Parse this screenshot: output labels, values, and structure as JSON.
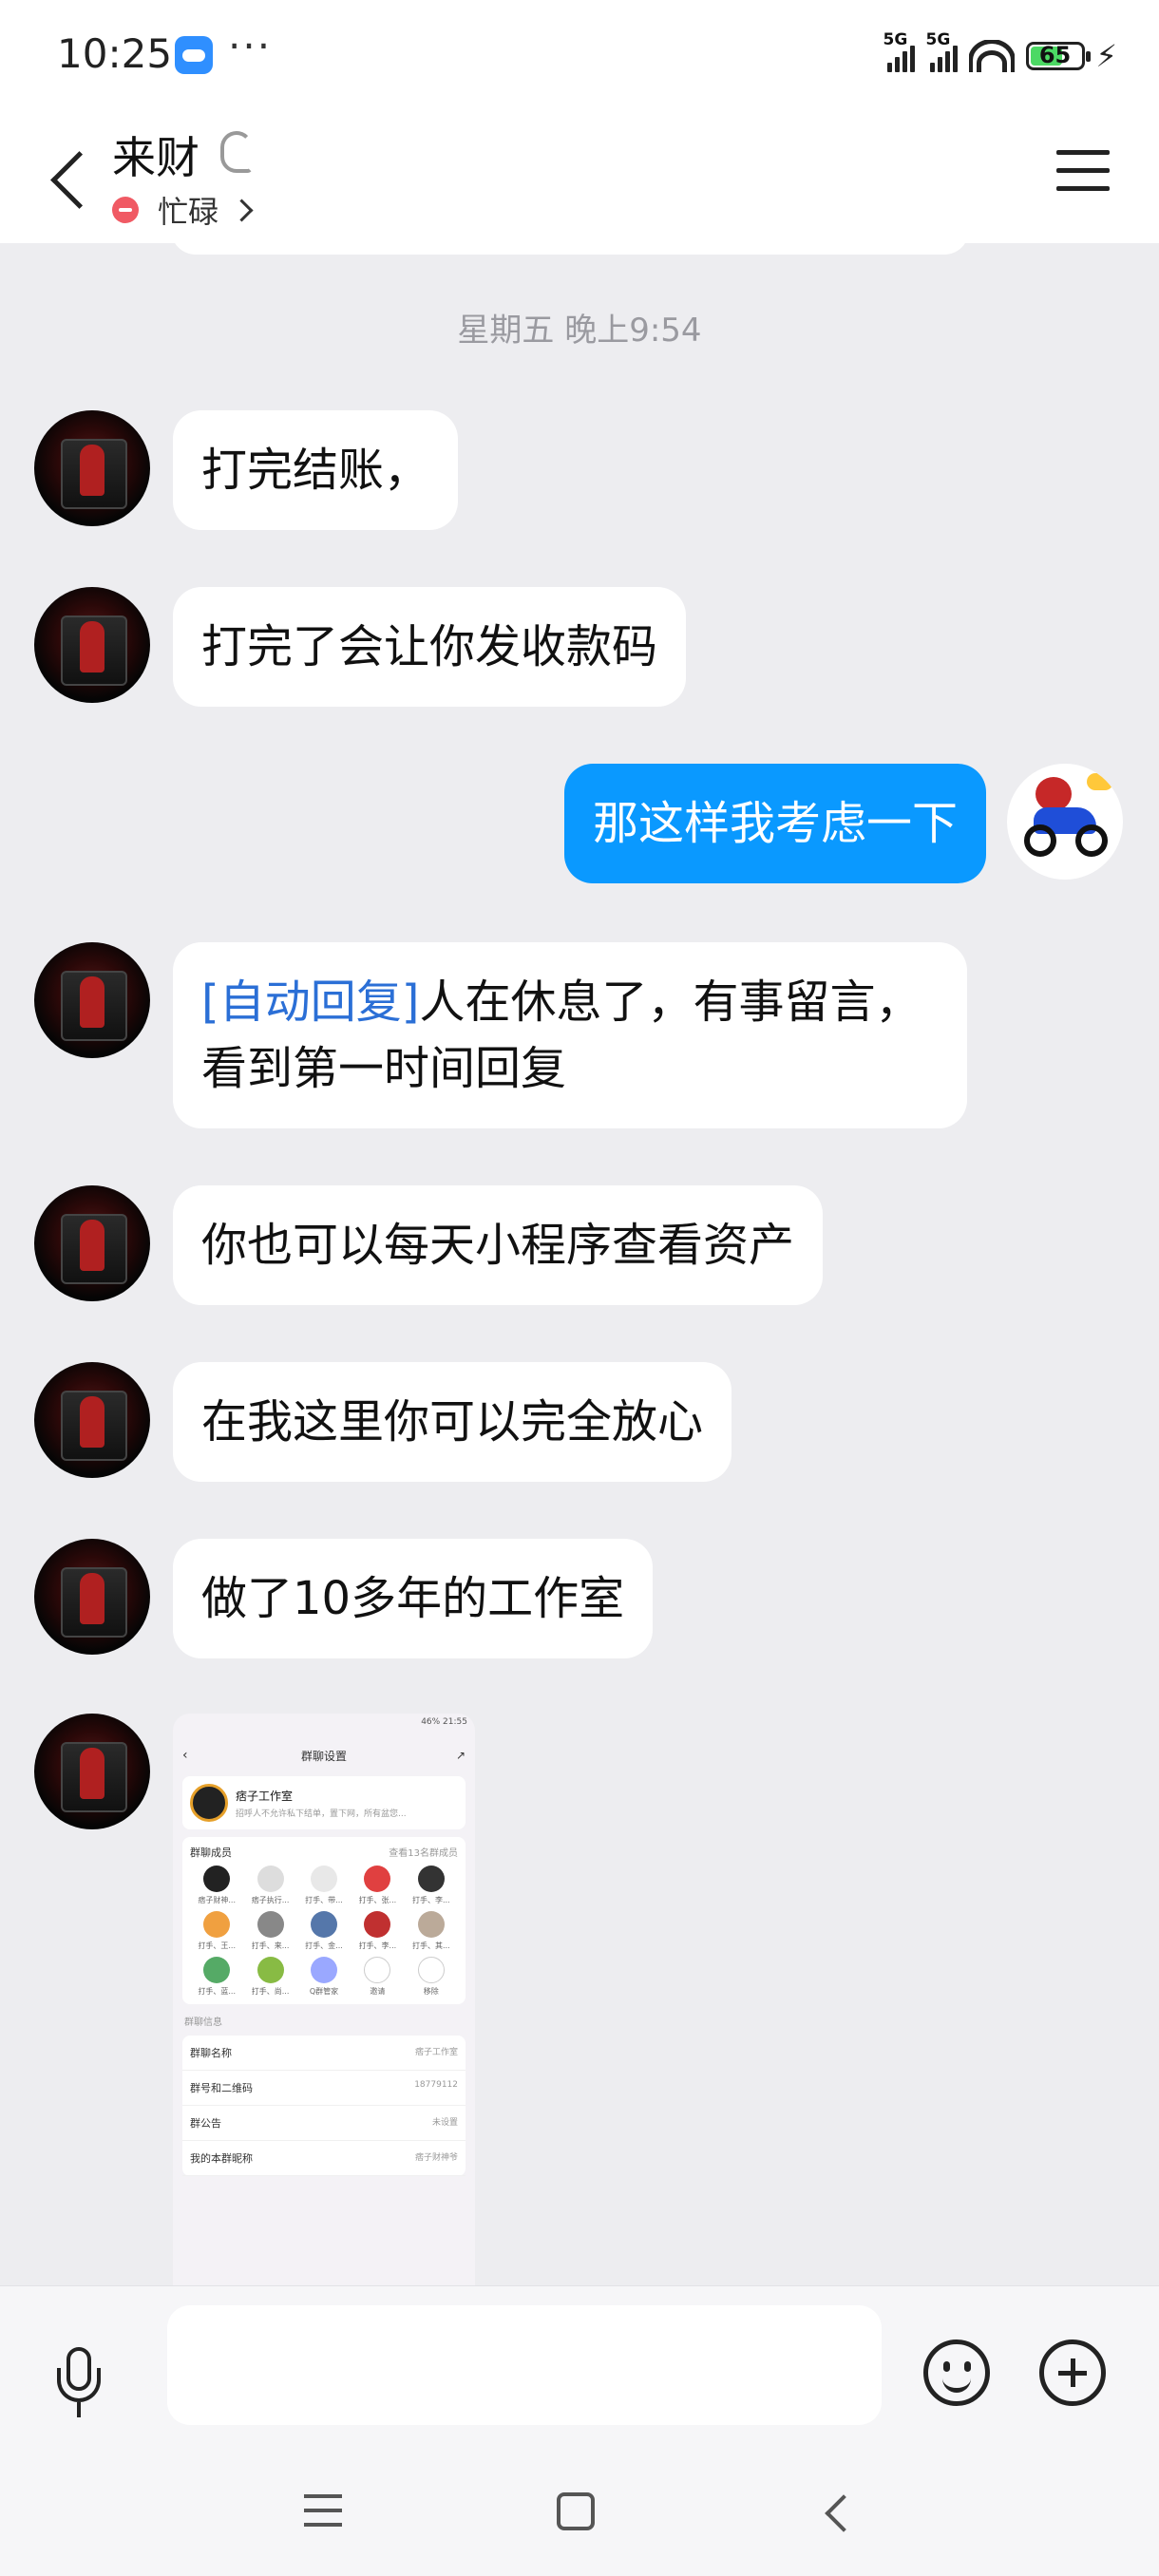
{
  "status_bar": {
    "time": "10:25",
    "more": "···",
    "signal1": "5G",
    "signal2": "5G",
    "battery": "65"
  },
  "header": {
    "title": "来财",
    "status": "忙碌"
  },
  "chat": {
    "timestamp": "星期五 晚上9:54",
    "messages": [
      {
        "from": "other",
        "text": "打完结账，"
      },
      {
        "from": "other",
        "text": "打完了会让你发收款码"
      },
      {
        "from": "me",
        "text": "那这样我考虑一下"
      },
      {
        "from": "other",
        "prefix": "[自动回复]",
        "text": "人在休息了，有事留言，看到第一时间回复"
      },
      {
        "from": "other",
        "text": "你也可以每天小程序查看资产"
      },
      {
        "from": "other",
        "text": "在我这里你可以完全放心"
      },
      {
        "from": "other",
        "text": "做了10多年的工作室"
      }
    ],
    "screenshot": {
      "status_left": "",
      "status_right": "46% 21:55",
      "title": "群聊设置",
      "group_name": "痞子工作室",
      "group_desc": "招呼人不允许私下结单，置下网，所有盆您...",
      "members_label": "群聊成员",
      "members_link": "查看13名群成员",
      "members": [
        "痞子财神...",
        "痞子执行...",
        "打手、带...",
        "打手、张...",
        "打手、李...",
        "打手、王...",
        "打手、来...",
        "打手、金...",
        "打手、李...",
        "打手、其...",
        "打手、蓝...",
        "打手、尚...",
        "Q群管家",
        "邀请",
        "移除"
      ],
      "section_label": "群聊信息",
      "rows": [
        {
          "label": "群聊名称",
          "value": "痞子工作室"
        },
        {
          "label": "群号和二维码",
          "value": "18779112"
        },
        {
          "label": "群公告",
          "value": "未设置"
        },
        {
          "label": "我的本群昵称",
          "value": "痞子财神爷"
        }
      ]
    }
  },
  "colors": {
    "my_bubble": "#0a99ff",
    "auto_reply": "#2b6fd6",
    "busy": "#f05a64",
    "battery": "#4cd964"
  },
  "icons": [
    "back-icon",
    "ear-icon",
    "menu-icon",
    "mic-icon",
    "emoji-icon",
    "plus-icon"
  ]
}
